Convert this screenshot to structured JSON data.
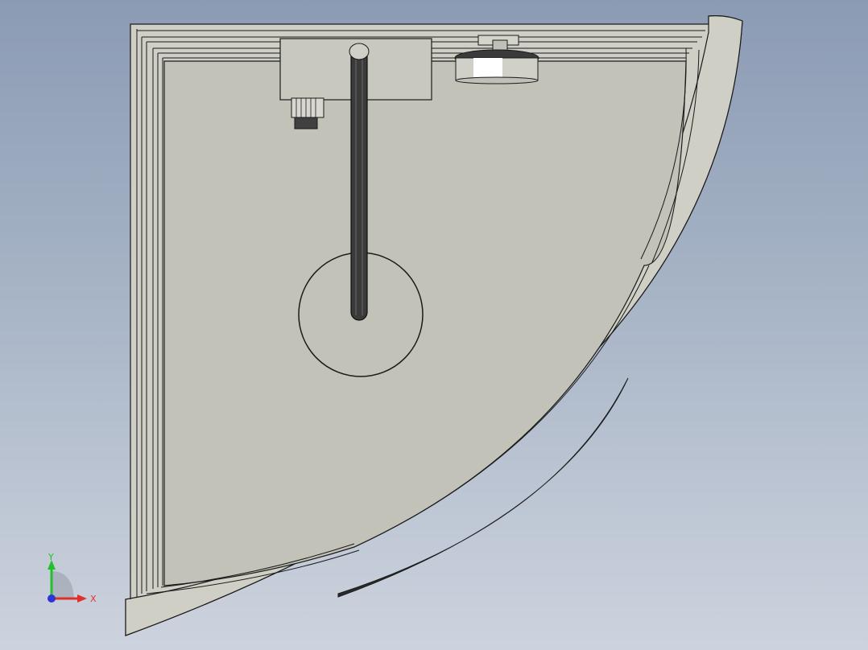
{
  "viewport": {
    "background_top": "#8b9bb4",
    "background_bottom": "#cdd3de"
  },
  "model": {
    "edge_color": "#1a1a1a",
    "face_color": "#c2c2b8",
    "frame_color": "#cfcfc5"
  },
  "triad": {
    "y_label": "Y",
    "x_label": "X",
    "y_color": "#22c02a",
    "x_color": "#e0302a",
    "z_color": "#2a34d8"
  }
}
